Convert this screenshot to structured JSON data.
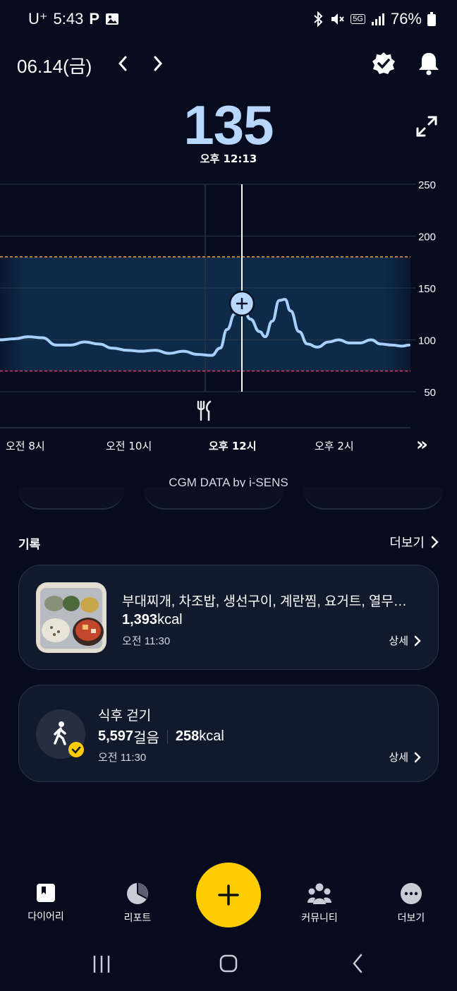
{
  "status_bar": {
    "carrier": "U⁺",
    "time": "5:43",
    "app_icon": "P",
    "network": "5G",
    "battery": "76%"
  },
  "header": {
    "date": "06.14(금)"
  },
  "glucose": {
    "value": "135",
    "time": "오후 12:13"
  },
  "chart_data": {
    "type": "line",
    "y_ticks": [
      "250",
      "200",
      "150",
      "100",
      "50"
    ],
    "x_ticks": [
      "오전 8시",
      "오전 10시",
      "오후 12시",
      "오후 2시"
    ],
    "ylim": [
      50,
      250
    ],
    "target_range": [
      70,
      180
    ],
    "selected_point": {
      "time": "오후 12:13",
      "value": 135
    },
    "series": [
      {
        "values": [
          [
            0,
            100
          ],
          [
            20,
            101
          ],
          [
            40,
            103
          ],
          [
            60,
            102
          ],
          [
            80,
            95
          ],
          [
            100,
            95
          ],
          [
            120,
            98
          ],
          [
            140,
            96
          ],
          [
            160,
            92
          ],
          [
            180,
            90
          ],
          [
            200,
            89
          ],
          [
            220,
            90
          ],
          [
            240,
            87
          ],
          [
            260,
            89
          ],
          [
            280,
            86
          ],
          [
            300,
            85
          ],
          [
            312,
            92
          ],
          [
            322,
            110
          ],
          [
            333,
            125
          ],
          [
            343,
            135
          ],
          [
            355,
            120
          ],
          [
            368,
            108
          ],
          [
            376,
            103
          ],
          [
            386,
            118
          ],
          [
            396,
            138
          ],
          [
            404,
            139
          ],
          [
            412,
            128
          ],
          [
            424,
            108
          ],
          [
            436,
            96
          ],
          [
            450,
            93
          ],
          [
            466,
            98
          ],
          [
            480,
            100
          ],
          [
            496,
            97
          ],
          [
            510,
            97
          ],
          [
            526,
            100
          ],
          [
            540,
            96
          ],
          [
            556,
            95
          ],
          [
            570,
            94
          ],
          [
            580,
            95
          ]
        ]
      }
    ]
  },
  "chart": {
    "meal_marker": "fork-knife-icon",
    "next": "»"
  },
  "credit": "CGM DATA by i-SENS",
  "records": {
    "title": "기록",
    "more": "더보기",
    "meal": {
      "title": "부대찌개, 차조밥, 생선구이, 계란찜, 요거트, 열무…",
      "kcal_num": "1,393",
      "kcal_unit": "kcal",
      "time": "오전 11:30",
      "detail": "상세"
    },
    "walk": {
      "title": "식후 걷기",
      "steps_num": "5,597",
      "steps_unit": "걸음",
      "kcal_num": "258",
      "kcal_unit": "kcal",
      "time": "오전 11:30",
      "detail": "상세"
    }
  },
  "nav": {
    "diary": "다이어리",
    "report": "리포트",
    "community": "커뮤니티",
    "more": "더보기"
  },
  "colors": {
    "accent": "#ffcc00",
    "glucose": "#b7d7ff",
    "line": "#a8d0ff",
    "upper_limit": "#f2a33a",
    "lower_limit": "#e0386a"
  }
}
